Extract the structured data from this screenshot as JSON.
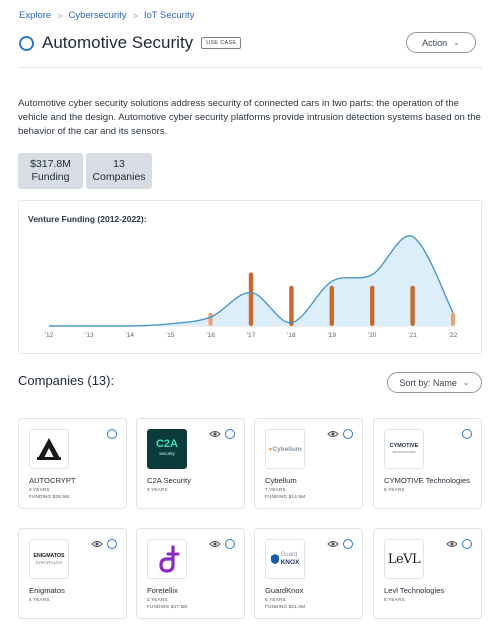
{
  "breadcrumb": {
    "items": [
      "Explore",
      "Cybersecurity",
      "IoT Security"
    ],
    "separator": ">"
  },
  "header": {
    "title": "Automotive Security",
    "badge": "USE CASE",
    "action_label": "Action",
    "action_icon": "chevron-down-icon"
  },
  "description": "Automotive cyber security solutions address security of connected cars in two parts: the operation of the vehicle and the design. Automotive cyber security platforms provide intrusion detection systems based on the behavior of the car and its sensors.",
  "stats": {
    "funding": {
      "value": "$317.8M",
      "label": "Funding"
    },
    "companies": {
      "value": "13",
      "label": "Companies"
    }
  },
  "chart_data": {
    "type": "area",
    "title": "Venture Funding (2012-2022):",
    "categories": [
      "'12",
      "'13",
      "'14",
      "'15",
      "'16",
      "'17",
      "'18",
      "'19",
      "'20",
      "'21",
      "'22"
    ],
    "series": [
      {
        "type": "area",
        "values": [
          0,
          0,
          0,
          2,
          8,
          30,
          3,
          40,
          46,
          80,
          12
        ]
      },
      {
        "type": "bar",
        "values": [
          0,
          0,
          0,
          0,
          12,
          48,
          36,
          36,
          36,
          36,
          12
        ]
      }
    ],
    "colors": {
      "area_fill": "#dbeefa",
      "line": "#4d97c8",
      "bar_strong": "#c8682b",
      "bar_light": "#e8a57d",
      "axis": "#dde2e7"
    }
  },
  "companies_section": {
    "title": "Companies (13):",
    "sort_label": "Sort by: Name",
    "sort_icon": "chevron-down-icon"
  },
  "companies": [
    {
      "name": "AUTOCRYPT",
      "years": "3 YEARS",
      "funding": "FUNDING $38.5M",
      "has_eye": false,
      "logo_icon": "autocrypt-logo-icon"
    },
    {
      "name": "C2A Security",
      "years": "3 YEARS",
      "funding": "",
      "has_eye": true,
      "logo_icon": "c2a-logo-icon"
    },
    {
      "name": "Cybellum",
      "years": "7 YEARS",
      "funding": "FUNDING $14.5M",
      "has_eye": true,
      "logo_icon": "cybellum-logo-icon"
    },
    {
      "name": "CYMOTIVE Technologies",
      "years": "6 YEARS",
      "funding": "",
      "has_eye": false,
      "logo_icon": "cymotive-logo-icon"
    },
    {
      "name": "Enigmatos",
      "years": "4 YEARS",
      "funding": "",
      "has_eye": true,
      "logo_icon": "enigmatos-logo-icon"
    },
    {
      "name": "Foretellix",
      "years": "3 YEARS",
      "funding": "FUNDING $47.5M",
      "has_eye": true,
      "logo_icon": "foretellix-logo-icon"
    },
    {
      "name": "GuardKnox",
      "years": "5 YEARS",
      "funding": "FUNDING $21.0M",
      "has_eye": true,
      "logo_icon": "guardknox-logo-icon"
    },
    {
      "name": "Levl Technologies",
      "years": "5 YEARS",
      "funding": "",
      "has_eye": true,
      "logo_icon": "levl-logo-icon"
    }
  ],
  "logos": {
    "c2a": {
      "main": "C2A",
      "sub": "security"
    },
    "cybellum": "Cybellum",
    "cymotive": {
      "main": "CYMOTIVE",
      "sub": "TECHNOLOGIES"
    },
    "enigmatos": {
      "main": "ENIGMATOS",
      "sub": "ENIGMATOS"
    },
    "guardknox": {
      "top": "Guard",
      "bottom": "KNOX"
    },
    "levl": "LeVL"
  }
}
